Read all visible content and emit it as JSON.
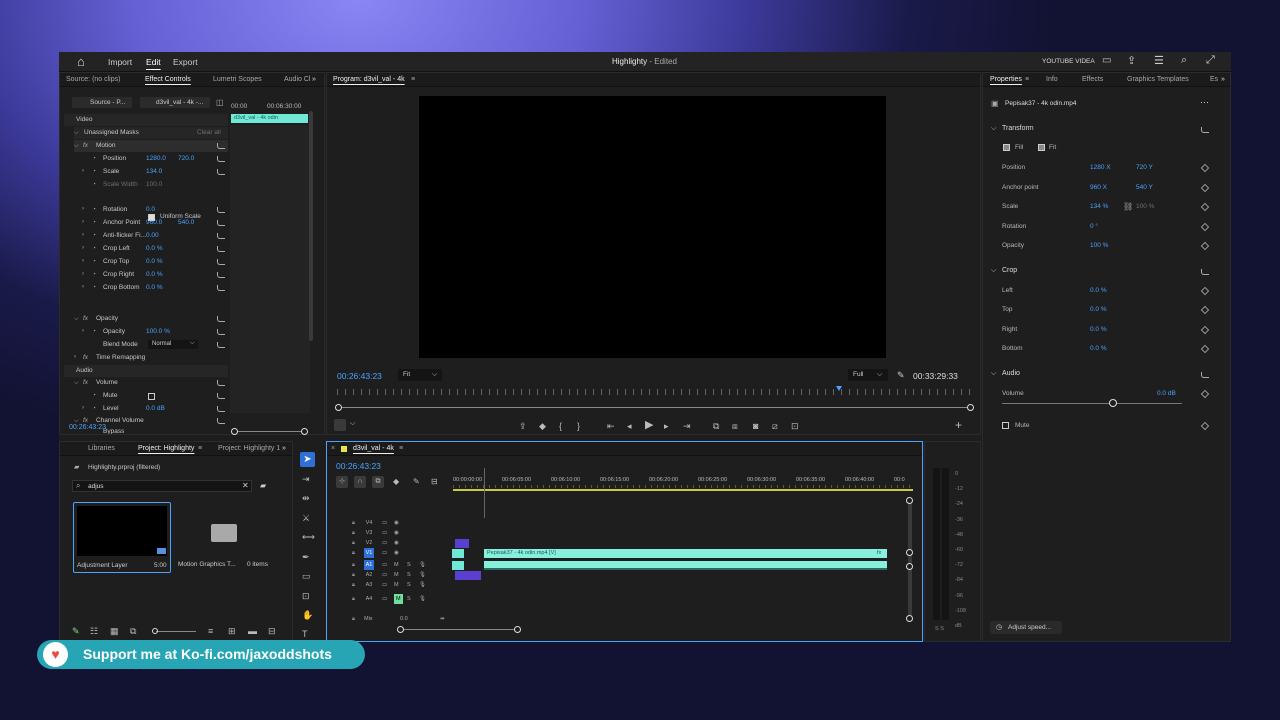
{
  "topbar": {
    "home": "⌂",
    "import": "Import",
    "edit": "Edit",
    "export": "Export",
    "title": "Highlighty",
    "edited": " - Edited",
    "workspace": "YOUTUBE VIDEA"
  },
  "left_tabs": [
    "Source: (no clips)",
    "Effect Controls",
    "Lumetri Scopes",
    "Audio Cl"
  ],
  "ec": {
    "source_btn": "Source - P...",
    "clip_btn": "d3vil_val - 4k -...",
    "t0": "00:00",
    "t1": "00:06:30:00",
    "clip_label": "d3vil_val - 4k odin",
    "video": "Video",
    "unassigned": "Unassigned Masks",
    "clear_all": "Clear all",
    "motion": "Motion",
    "props": [
      {
        "name": "Position",
        "v1": "1280.0",
        "v2": "720.0"
      },
      {
        "name": "Scale",
        "v1": "134.0"
      },
      {
        "name": "Scale Width",
        "v1": "100.0",
        "disabled": true
      },
      {
        "name": "Rotation",
        "v1": "0.0"
      },
      {
        "name": "Anchor Point",
        "v1": "960.0",
        "v2": "540.0"
      },
      {
        "name": "Anti-flicker Fi...",
        "v1": "0.00"
      },
      {
        "name": "Crop Left",
        "v1": "0.0 %"
      },
      {
        "name": "Crop Top",
        "v1": "0.0 %"
      },
      {
        "name": "Crop Right",
        "v1": "0.0 %"
      },
      {
        "name": "Crop Bottom",
        "v1": "0.0 %"
      }
    ],
    "uniform_scale": "Uniform Scale",
    "opacity_group": "Opacity",
    "opacity": "Opacity",
    "opacity_val": "100.0 %",
    "blend": "Blend Mode",
    "blend_val": "Normal",
    "time_remap": "Time Remapping",
    "audio": "Audio",
    "volume": "Volume",
    "mute": "Mute",
    "level": "Level",
    "level_val": "0.0 dB",
    "channel_volume": "Channel Volume",
    "bypass": "Bypass",
    "timecode": "00:26:43:23"
  },
  "program": {
    "title": "Program: d3vil_val - 4k",
    "timecode": "00:26:43:23",
    "fit": "Fit",
    "full": "Full",
    "duration": "00:33:29:33"
  },
  "props_panel": {
    "tabs": [
      "Properties",
      "Info",
      "Effects",
      "Graphics Templates",
      "Es"
    ],
    "clip": "Pepisak37 - 4k odin.mp4",
    "transform": "Transform",
    "fill": "Fill",
    "fit": "Fit",
    "rows": [
      {
        "label": "Position",
        "v1": "1280 X",
        "v2": "720 Y"
      },
      {
        "label": "Anchor point",
        "v1": "960 X",
        "v2": "540 Y"
      },
      {
        "label": "Scale",
        "v1": "134 %",
        "v2": "100 %"
      },
      {
        "label": "Rotation",
        "v1": "0 °"
      },
      {
        "label": "Opacity",
        "v1": "100 %"
      }
    ],
    "crop": "Crop",
    "crop_rows": [
      {
        "label": "Left",
        "v": "0.0 %"
      },
      {
        "label": "Top",
        "v": "0.0 %"
      },
      {
        "label": "Right",
        "v": "0.0 %"
      },
      {
        "label": "Bottom",
        "v": "0.0 %"
      }
    ],
    "audio": "Audio",
    "volume": "Volume",
    "volume_val": "0.0 dB",
    "mute": "Mute",
    "adjust": "Adjust speed..."
  },
  "project": {
    "tabs": [
      "Libraries",
      "Project: Highlighty",
      "Project: Highlighty 1"
    ],
    "path": "Highlighty.prproj (filtered)",
    "search": "adjus",
    "items": [
      {
        "name": "Adjustment Layer",
        "meta": "5:00"
      },
      {
        "name": "Motion Graphics T...",
        "meta": "0 items"
      }
    ]
  },
  "timeline": {
    "tab": "d3vil_val - 4k",
    "timecode": "00:26:43:23",
    "ruler": [
      "00:00:00:00",
      "00:06:05:00",
      "00:06:10:00",
      "00:06:15:00",
      "00:06:20:00",
      "00:06:25:00",
      "00:06:30:00",
      "00:06:35:00",
      "00:06:40:00",
      "00:0"
    ],
    "tracks": [
      "V4",
      "V3",
      "V2",
      "V1",
      "A1",
      "A2",
      "A3",
      "A4"
    ],
    "mix": "Mix",
    "mix_val": "0.0",
    "clip": "Pepisak37 - 4k odin.mp4 [V]",
    "fx": "fx"
  },
  "meter": {
    "labels": [
      "0",
      "-12",
      "-24",
      "-36",
      "-48",
      "-60",
      "-72",
      "-84",
      "-96",
      "-108",
      "dB"
    ],
    "sides": "S S"
  },
  "banner": {
    "text": "Support me at Ko-fi.com/jaxoddshots"
  }
}
